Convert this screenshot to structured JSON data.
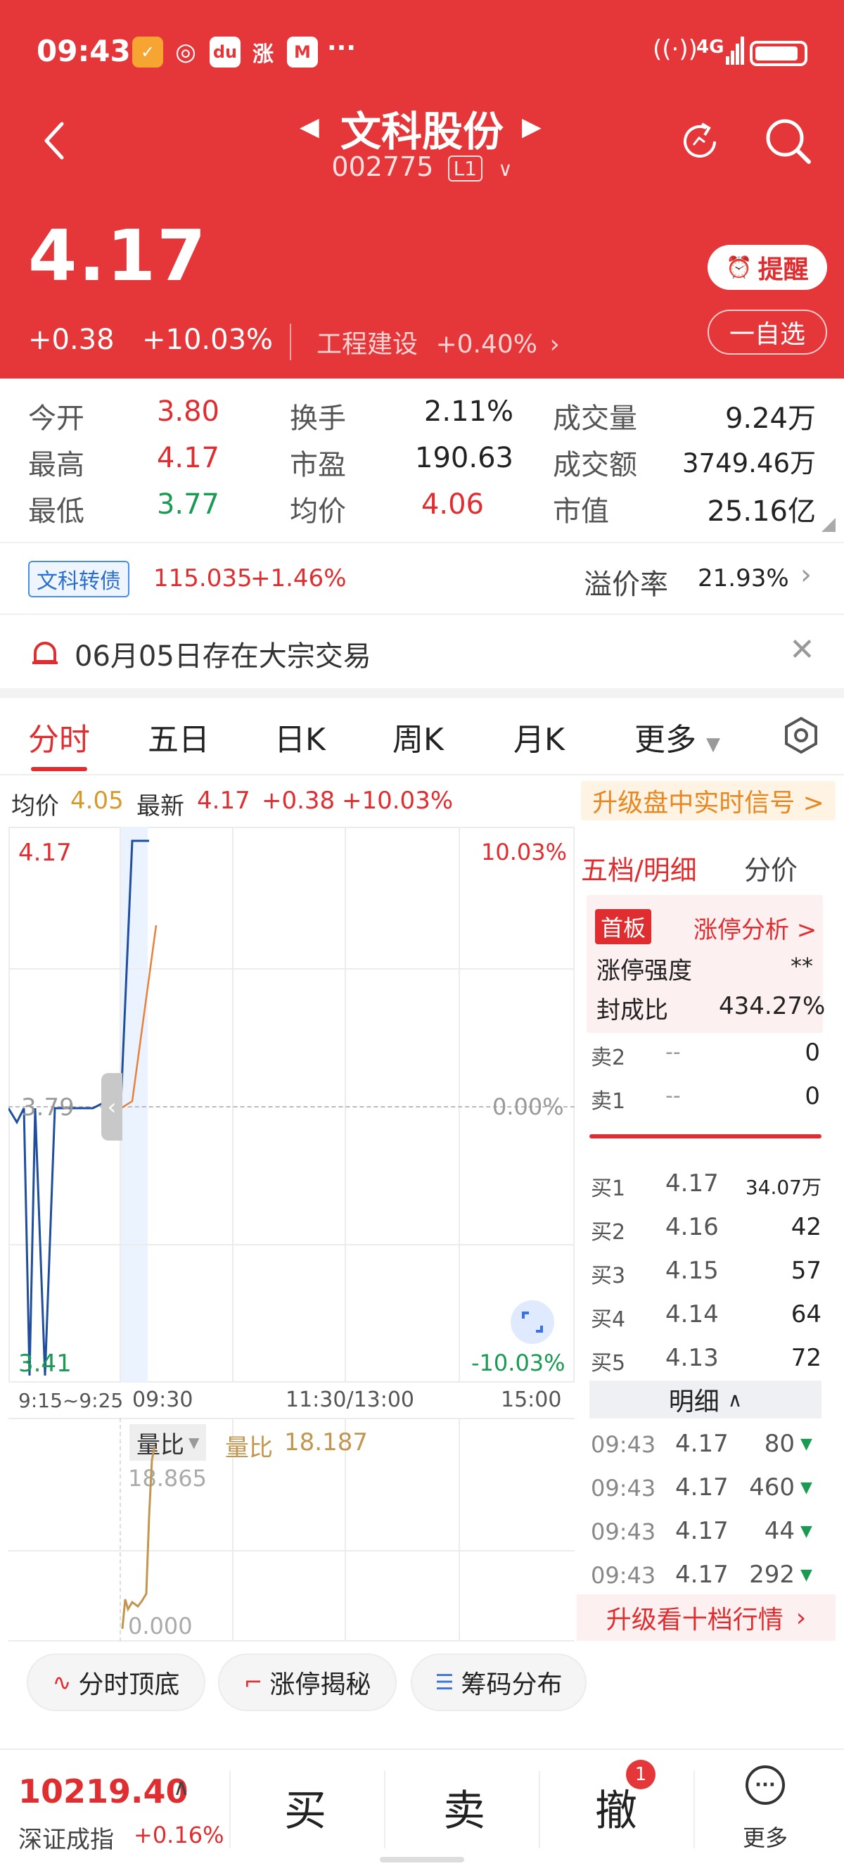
{
  "status_bar": {
    "time": "09:43",
    "network": "4G"
  },
  "header": {
    "name": "文科股份",
    "code": "002775",
    "level_badge": "L1",
    "price": "4.17",
    "change": "+0.38",
    "change_pct": "+10.03%",
    "sector": "工程建设",
    "sector_pct": "+0.40%",
    "remind_label": "提醒",
    "watchlist_label": "一自选"
  },
  "quotes": {
    "open_label": "今开",
    "open": "3.80",
    "turnover_label": "换手",
    "turnover": "2.11%",
    "volume_label": "成交量",
    "volume": "9.24万",
    "high_label": "最高",
    "high": "4.17",
    "pe_label": "市盈",
    "pe": "190.63",
    "amount_label": "成交额",
    "amount": "3749.46万",
    "low_label": "最低",
    "low": "3.77",
    "avg_label": "均价",
    "avg": "4.06",
    "mcap_label": "市值",
    "mcap": "25.16亿"
  },
  "bond": {
    "tag": "文科转债",
    "price": "115.035",
    "pct": "+1.46%",
    "premium_label": "溢价率",
    "premium": "21.93%"
  },
  "notice": {
    "text": "06月05日存在大宗交易"
  },
  "tabs": [
    "分时",
    "五日",
    "日K",
    "周K",
    "月K",
    "更多"
  ],
  "chart_info": {
    "avg_label": "均价",
    "avg": "4.05",
    "latest_label": "最新",
    "latest": "4.17",
    "change": "+0.38",
    "change_pct": "+10.03%",
    "upgrade": "升级盘中实时信号 >"
  },
  "chart_data": {
    "type": "line",
    "x_ticks": [
      "9:15~9:25",
      "09:30",
      "11:30/13:00",
      "15:00"
    ],
    "y_left_ticks": [
      "4.17",
      "3.79",
      "3.41"
    ],
    "y_right_ticks": [
      "10.03%",
      "0.00%",
      "-10.03%"
    ],
    "ylim": [
      3.41,
      4.17
    ],
    "series": [
      {
        "values": [
          3.79,
          3.77,
          3.79,
          3.41,
          3.79,
          3.41,
          3.79,
          3.79,
          3.79,
          3.8,
          3.79,
          3.8,
          4.17,
          4.17
        ]
      },
      {
        "values": [
          3.8,
          3.79,
          3.8,
          4.05
        ]
      }
    ]
  },
  "volume_ratio": {
    "selector": "量比",
    "label": "量比",
    "value": "18.187",
    "max": "18.865",
    "min": "0.000"
  },
  "order_book": {
    "tab_depth": "五档/明细",
    "tab_price": "分价",
    "board_tag": "首板",
    "limit_analysis": "涨停分析 >",
    "strength_label": "涨停强度",
    "strength": "**",
    "seal_label": "封成比",
    "seal": "434.27%",
    "sells": [
      {
        "label": "卖2",
        "price": "--",
        "vol": "0"
      },
      {
        "label": "卖1",
        "price": "--",
        "vol": "0"
      }
    ],
    "buys": [
      {
        "label": "买1",
        "price": "4.17",
        "vol": "34.07万"
      },
      {
        "label": "买2",
        "price": "4.16",
        "vol": "42"
      },
      {
        "label": "买3",
        "price": "4.15",
        "vol": "57"
      },
      {
        "label": "买4",
        "price": "4.14",
        "vol": "64"
      },
      {
        "label": "买5",
        "price": "4.13",
        "vol": "72"
      }
    ],
    "detail_label": "明细",
    "details": [
      {
        "time": "09:43",
        "price": "4.17",
        "vol": "80"
      },
      {
        "time": "09:43",
        "price": "4.17",
        "vol": "460"
      },
      {
        "time": "09:43",
        "price": "4.17",
        "vol": "44"
      },
      {
        "time": "09:43",
        "price": "4.17",
        "vol": "292"
      }
    ],
    "upgrade_ten": "升级看十档行情"
  },
  "tools": [
    "分时顶底",
    "涨停揭秘",
    "筹码分布"
  ],
  "bottom": {
    "index_value": "10219.40",
    "index_name": "深证成指",
    "index_pct": "+0.16%",
    "buy": "买",
    "sell": "卖",
    "cancel": "撤",
    "cancel_badge": "1",
    "more": "更多"
  }
}
